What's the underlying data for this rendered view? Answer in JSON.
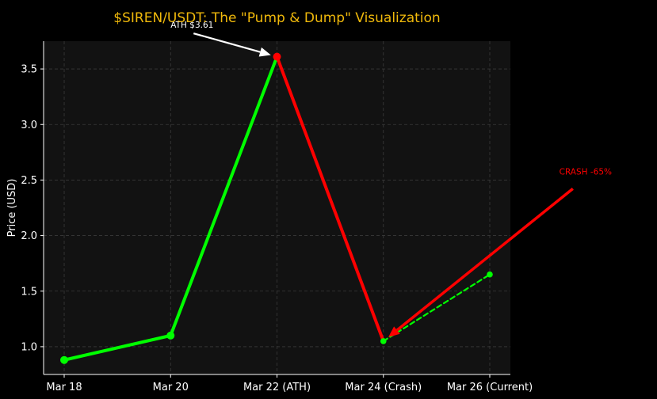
{
  "chart_data": {
    "type": "line",
    "title": "$SIREN/USDT: The \"Pump & Dump\" Visualization",
    "xlabel": "",
    "ylabel": "Price (USD)",
    "categories": [
      "Mar 18",
      "Mar 20",
      "Mar 22 (ATH)",
      "Mar 24 (Crash)",
      "Mar 26 (Current)"
    ],
    "ylim": [
      0.75,
      3.75
    ],
    "yticks": [
      1.0,
      1.5,
      2.0,
      2.5,
      3.0,
      3.5
    ],
    "ytick_labels": [
      "1.0",
      "1.5",
      "2.0",
      "2.5",
      "3.0",
      "3.5"
    ],
    "grid": true,
    "series": [
      {
        "segment": "pump",
        "x": [
          0,
          1,
          2
        ],
        "values": [
          0.88,
          1.1,
          3.61
        ],
        "color": "#00ff00",
        "style": "solid"
      },
      {
        "segment": "dump",
        "x": [
          2,
          3
        ],
        "values": [
          3.61,
          1.05
        ],
        "color": "#ff0000",
        "style": "solid"
      },
      {
        "segment": "recovery",
        "x": [
          3,
          4
        ],
        "values": [
          1.05,
          1.65
        ],
        "color": "#00ff00",
        "style": "dashed"
      }
    ],
    "markers": [
      {
        "x": 0,
        "y": 0.88,
        "color": "#00ff00"
      },
      {
        "x": 1,
        "y": 1.1,
        "color": "#00ff00"
      },
      {
        "x": 2,
        "y": 3.61,
        "color": "#ff0000"
      },
      {
        "x": 3,
        "y": 1.05,
        "color": "#00ff00"
      },
      {
        "x": 4,
        "y": 1.65,
        "color": "#00ff00"
      }
    ],
    "annotations": [
      {
        "text": "ATH $3.61",
        "target_x": 2,
        "target_y": 3.61,
        "text_x": 1.0,
        "text_y": 3.87,
        "color": "#ffffff"
      },
      {
        "text": "CRASH -65%",
        "target_x": 3,
        "target_y": 1.05,
        "text_x": 4.9,
        "text_y": 2.55,
        "color": "#ff0000"
      }
    ],
    "colors": {
      "background": "#000000",
      "plot_background": "#121212",
      "grid": "#3a3a3a",
      "title": "#f0b90b",
      "axis": "#ffffff"
    }
  }
}
